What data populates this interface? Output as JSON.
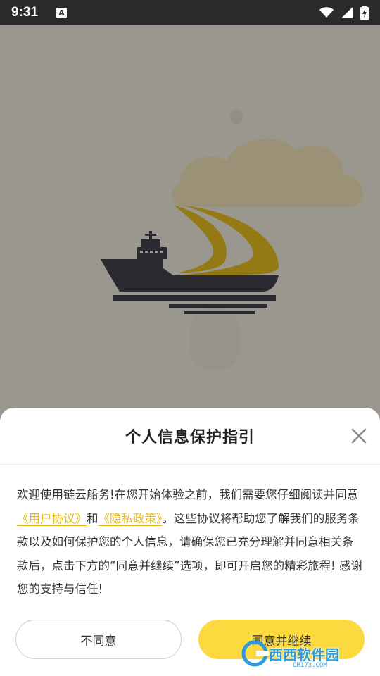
{
  "status_bar": {
    "time": "9:31",
    "keyboard_badge": "A"
  },
  "dialog": {
    "title": "个人信息保护指引",
    "body": {
      "prefix": "欢迎使用链云船务!在您开始体验之前，我们需要您仔细阅读并同意",
      "user_agreement_link": "《用户协议》",
      "conjunction": "和",
      "privacy_policy_link": "《隐私政策》",
      "suffix": "。这些协议将帮助您了解我们的服务条款以及如何保护您的个人信息，请确保您已充分理解并同意相关条款后，点击下方的“同意并继续”选项，即可开启您的精彩旅程! 感谢您的支持与信任!"
    },
    "disagree_button": "不同意",
    "agree_button": "同意并继续"
  },
  "watermark": {
    "text": "西西软件园",
    "sub": "CR173.COM"
  },
  "colors": {
    "accent_yellow": "#fdd940",
    "link_yellow": "#e7b80d",
    "logo_navy": "#16193a",
    "logo_gold": "#f2c200"
  },
  "icons": [
    "wifi-icon",
    "signal-icon",
    "battery-charging-icon",
    "close-icon",
    "ship-logo-icon",
    "cloud-icon"
  ]
}
